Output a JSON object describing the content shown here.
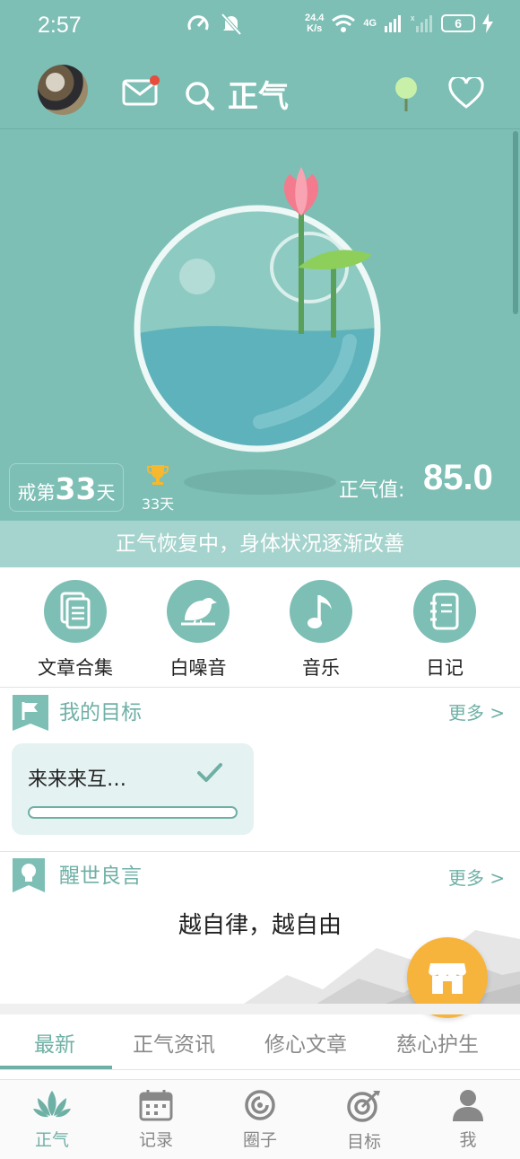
{
  "status_bar": {
    "time": "2:57",
    "net_speed_value": "24.4",
    "net_speed_unit": "K/s",
    "network": "4G",
    "battery": "6"
  },
  "header": {
    "title": "正气"
  },
  "score": {
    "streak_prefix": "戒第",
    "streak_days": "33",
    "streak_suffix": "天",
    "best_days": "33天",
    "label": "正气值:",
    "value": "85.0"
  },
  "status_message": "正气恢复中，身体状况逐渐改善",
  "quick_actions": [
    {
      "label": "文章合集",
      "icon": "document-icon"
    },
    {
      "label": "白噪音",
      "icon": "bird-icon"
    },
    {
      "label": "音乐",
      "icon": "music-note-icon"
    },
    {
      "label": "日记",
      "icon": "notebook-icon"
    }
  ],
  "goals_section": {
    "title": "我的目标",
    "more": "更多 >",
    "goal": {
      "text": "来来来互…",
      "progress": 0.0
    }
  },
  "motto_section": {
    "title": "醒世良言",
    "more": "更多 >",
    "motto": "越自律，越自由"
  },
  "tabs": [
    "最新",
    "正气资讯",
    "修心文章",
    "慈心护生"
  ],
  "active_tab": 0,
  "bottom_nav": [
    {
      "label": "正气",
      "icon": "lotus-icon"
    },
    {
      "label": "记录",
      "icon": "calendar-icon"
    },
    {
      "label": "圈子",
      "icon": "circle-icon"
    },
    {
      "label": "目标",
      "icon": "target-icon"
    },
    {
      "label": "我",
      "icon": "person-icon"
    }
  ],
  "colors": {
    "primary": "#7dbfb5",
    "accent": "#6fb0a6",
    "fab": "#f6b43c"
  }
}
